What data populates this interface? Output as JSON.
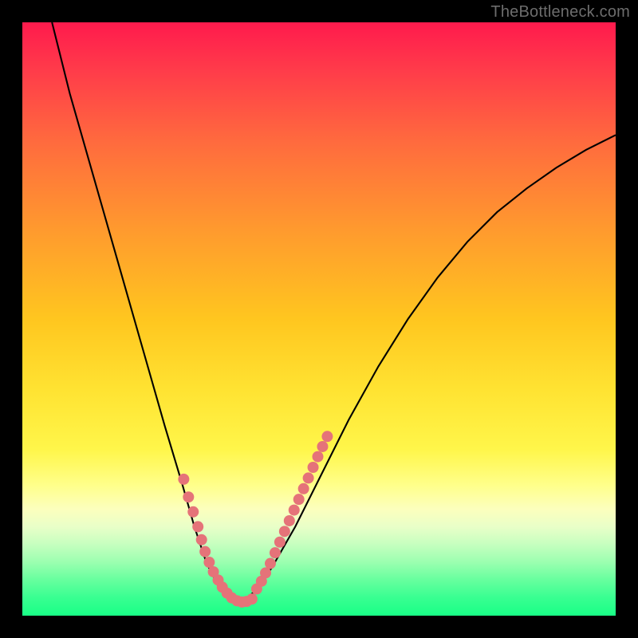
{
  "watermark": "TheBottleneck.com",
  "chart_data": {
    "type": "line",
    "title": "",
    "xlabel": "",
    "ylabel": "",
    "xlim": [
      0,
      100
    ],
    "ylim": [
      0,
      100
    ],
    "series": [
      {
        "name": "curve",
        "x": [
          5,
          8,
          12,
          16,
          20,
          24,
          27,
          29,
          31,
          33,
          34.5,
          36,
          37.5,
          39,
          42,
          46,
          50,
          55,
          60,
          65,
          70,
          75,
          80,
          85,
          90,
          95,
          100
        ],
        "y": [
          100,
          88,
          74,
          60,
          46,
          32,
          22,
          15,
          9,
          5,
          3,
          2,
          2.5,
          4,
          8,
          15,
          23,
          33,
          42,
          50,
          57,
          63,
          68,
          72,
          75.5,
          78.5,
          81
        ]
      }
    ],
    "markers": {
      "left_cluster": {
        "x": [
          27.2,
          28.0,
          28.8,
          29.6,
          30.2,
          30.8,
          31.5,
          32.2,
          33.0,
          33.7,
          34.5,
          35.3,
          36.2,
          37.0,
          37.8,
          38.7
        ],
        "y": [
          23.0,
          20.0,
          17.5,
          15.0,
          12.8,
          10.8,
          9.0,
          7.4,
          6.0,
          4.8,
          3.8,
          3.0,
          2.5,
          2.3,
          2.4,
          2.8
        ]
      },
      "right_cluster": {
        "x": [
          39.5,
          40.3,
          41.0,
          41.8,
          42.6,
          43.4,
          44.2,
          45.0,
          45.8,
          46.6,
          47.4,
          48.2,
          49.0,
          49.8,
          50.6,
          51.4
        ],
        "y": [
          4.5,
          5.8,
          7.2,
          8.8,
          10.6,
          12.4,
          14.2,
          16.0,
          17.8,
          19.6,
          21.4,
          23.2,
          25.0,
          26.8,
          28.5,
          30.2
        ]
      }
    },
    "marker_color": "#e57379",
    "marker_radius": 7
  }
}
